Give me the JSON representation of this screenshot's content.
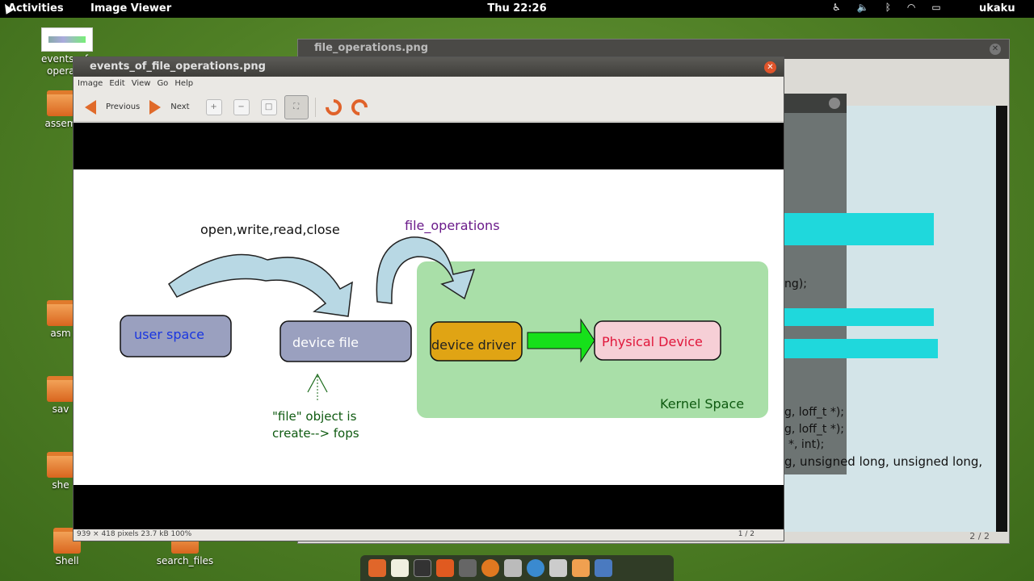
{
  "topbar": {
    "activities": "Activities",
    "app_menu": "Image Viewer",
    "clock": "Thu 22:26",
    "user": "ukaku"
  },
  "desktop_icons": [
    {
      "label": "events_of_\noperatio"
    },
    {
      "label": "assem"
    },
    {
      "label": "asm"
    },
    {
      "label": "sav"
    },
    {
      "label": "she"
    },
    {
      "label": "Shell"
    },
    {
      "label": "search_files"
    }
  ],
  "bg_window": {
    "title": "file_operations.png",
    "page": "2 / 2",
    "code_lines": [
      "ng);",
      "g, loff_t *);",
      "g, loff_t *);",
      "*, int);",
      "g, unsigned long, unsigned long,"
    ]
  },
  "main_window": {
    "title": "events_of_file_operations.png",
    "menu": [
      "Image",
      "Edit",
      "View",
      "Go",
      "Help"
    ],
    "toolbar": {
      "previous": "Previous",
      "next": "Next"
    },
    "status": {
      "info": "939 × 418 pixels  23.7 kB   100%",
      "page": "1 / 2"
    }
  },
  "diagram": {
    "label_ops": "open,write,read,close",
    "label_fops": "file_operations",
    "user_space": "user space",
    "device_file": "device file",
    "device_driver": "device driver",
    "physical_device": "Physical Device",
    "kernel_space": "Kernel Space",
    "file_obj_line1": "\"file\" object is",
    "file_obj_line2": "create--> fops"
  }
}
